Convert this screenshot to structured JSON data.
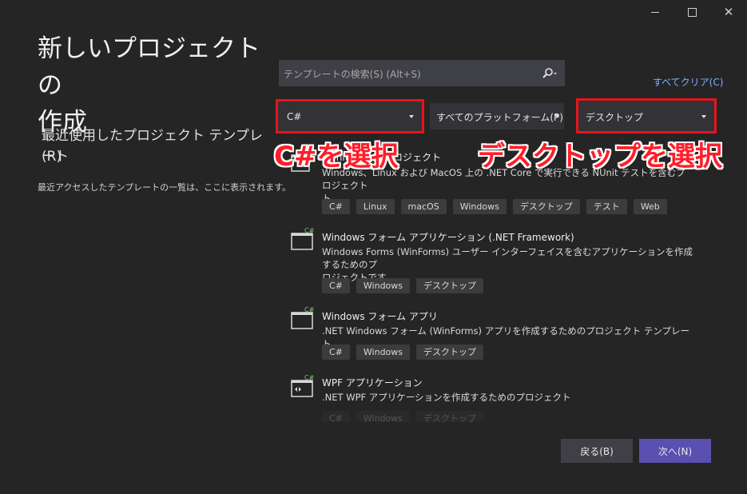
{
  "window": {
    "minimize_icon": "minimize-icon",
    "maximize_icon": "maximize-icon",
    "close_label": "✕"
  },
  "left": {
    "title_line1": "新しいプロジェクトの",
    "title_line2": "作成",
    "recent_line1": "最近使用したプロジェクト テンプレート",
    "recent_line2": "(R)",
    "recent_empty": "最近アクセスしたテンプレートの一覧は、ここに表示されます。"
  },
  "search": {
    "placeholder": "テンプレートの検索(S) (Alt+S)",
    "clear_all": "すべてクリア(C)"
  },
  "filters": {
    "language": "C#",
    "platform": "すべてのプラットフォーム(P)",
    "project_type": "デスクトップ"
  },
  "annotations": {
    "language": "C#を選択",
    "project_type": "デスクトップを選択"
  },
  "templates": [
    {
      "name": "NUnit テスト プロジェクト",
      "desc_line1": "Windows、Linux および MacOS 上の .NET Core で実行できる NUnit テストを含むプロジェクト",
      "desc_line2": "ト。",
      "tags": [
        "C#",
        "Linux",
        "macOS",
        "Windows",
        "デスクトップ",
        "テスト",
        "Web"
      ]
    },
    {
      "name": "Windows フォーム アプリケーション (.NET Framework)",
      "desc_line1": "Windows Forms (WinForms) ユーザー インターフェイスを含むアプリケーションを作成するためのプ",
      "desc_line2": "ロジェクトです",
      "tags": [
        "C#",
        "Windows",
        "デスクトップ"
      ]
    },
    {
      "name": "Windows フォーム アプリ",
      "desc_line1": ".NET Windows フォーム (WinForms) アプリを作成するためのプロジェクト テンプレート。",
      "tags": [
        "C#",
        "Windows",
        "デスクトップ"
      ]
    },
    {
      "name": "WPF アプリケーション",
      "desc_line1": ".NET WPF アプリケーションを作成するためのプロジェクト",
      "tags": [
        "C#",
        "Windows",
        "デスクトップ"
      ]
    }
  ],
  "buttons": {
    "back": "戻る(B)",
    "next": "次へ(N)"
  },
  "colors": {
    "background": "#252526",
    "accent": "#5b4fb0",
    "highlight": "#e8141b",
    "link": "#7fb0ff"
  }
}
